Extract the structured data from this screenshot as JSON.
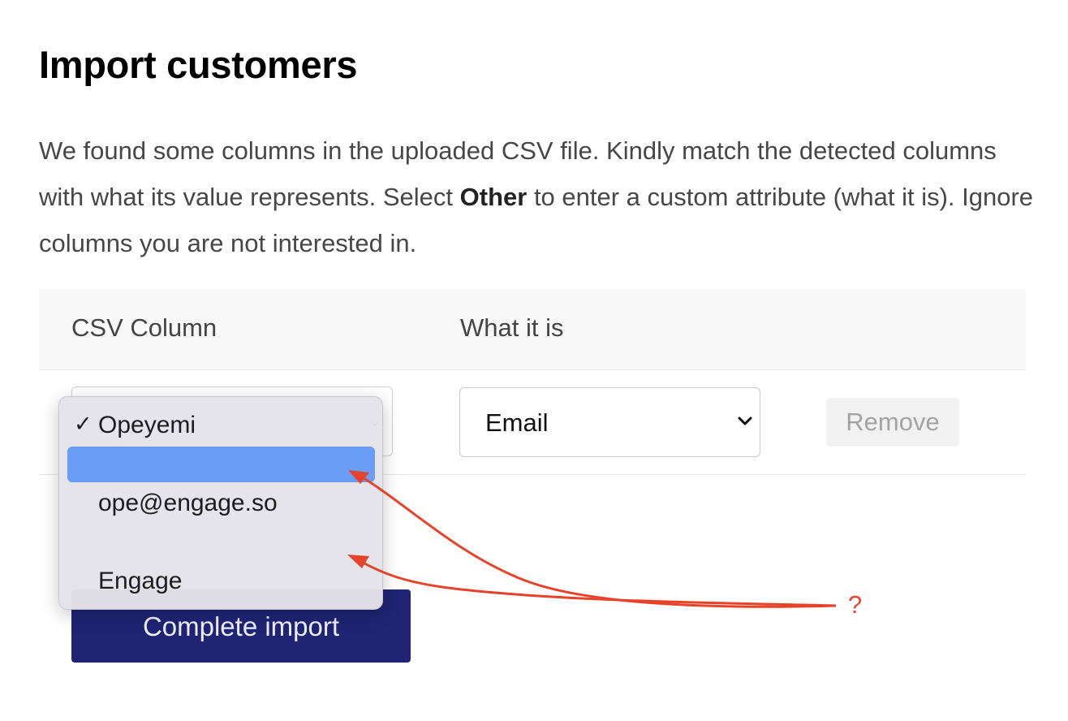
{
  "page": {
    "title": "Import customers",
    "intro_before": "We found some columns in the uploaded CSV file. Kindly match the detected columns with what its value represents. Select ",
    "intro_bold": "Other",
    "intro_after": " to enter a custom attribute (what it is). Ignore columns you are not interested in."
  },
  "table": {
    "headers": [
      "CSV Column",
      "What it is"
    ],
    "row": {
      "what_it_is_value": "Email",
      "remove_label": "Remove"
    }
  },
  "dropdown": {
    "checkmark": "✓",
    "options": [
      "Opeyemi",
      "",
      "ope@engage.so",
      "",
      "Engage"
    ],
    "selected_index": 0,
    "highlighted_index": 1
  },
  "actions": {
    "complete_label": "Complete import"
  },
  "annotation": {
    "label": "?",
    "color": "#e6432b"
  },
  "colors": {
    "primary_button": "#1f2474",
    "highlight": "#6a9df5"
  }
}
